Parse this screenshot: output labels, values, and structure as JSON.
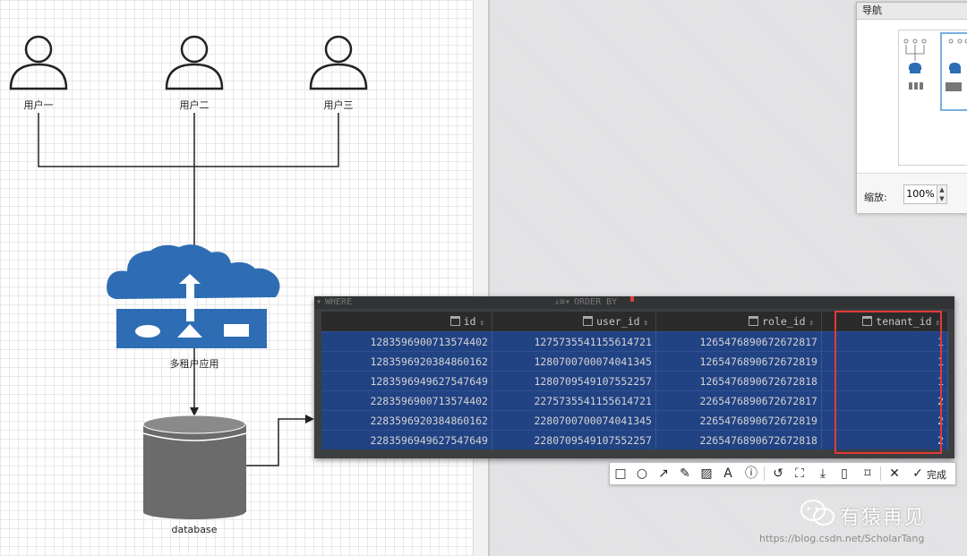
{
  "diagram": {
    "users": [
      "用户一",
      "用户二",
      "用户三"
    ],
    "app_label": "多租户应用",
    "db_label": "database"
  },
  "navigator": {
    "title": "导航",
    "zoom_label": "缩放:",
    "zoom_value": "100%"
  },
  "query_panel": {
    "where_label": "WHERE",
    "order_label": "ORDER BY",
    "columns": [
      "id",
      "user_id",
      "role_id",
      "tenant_id"
    ],
    "rows": [
      [
        "1283596900713574402",
        "1275735541155614721",
        "1265476890672672817",
        "1"
      ],
      [
        "1283596920384860162",
        "1280700700074041345",
        "1265476890672672819",
        "1"
      ],
      [
        "1283596949627547649",
        "1280709549107552257",
        "1265476890672672818",
        "1"
      ],
      [
        "2283596900713574402",
        "2275735541155614721",
        "2265476890672672817",
        "2"
      ],
      [
        "2283596920384860162",
        "2280700700074041345",
        "2265476890672672819",
        "2"
      ],
      [
        "2283596949627547649",
        "2280709549107552257",
        "2265476890672672818",
        "2"
      ]
    ],
    "highlight_color": "#e53935"
  },
  "toolbar": {
    "tools": [
      "rectangle-icon",
      "circle-icon",
      "arrow-icon",
      "pencil-icon",
      "mosaic-icon",
      "text-icon",
      "number-icon",
      "undo-icon",
      "crop-icon",
      "save-icon",
      "pin-icon",
      "bookmark-icon",
      "close-icon",
      "check-icon"
    ],
    "done_label": "完成"
  },
  "watermark": {
    "brand": "有猿再见",
    "url": "https://blog.csdn.net/ScholarTang"
  },
  "colors": {
    "cloud": "#2e6db4",
    "db_cylinder": "#6b6b6b",
    "grid_selection": "#214283",
    "panel_bg": "#3c3f41"
  }
}
